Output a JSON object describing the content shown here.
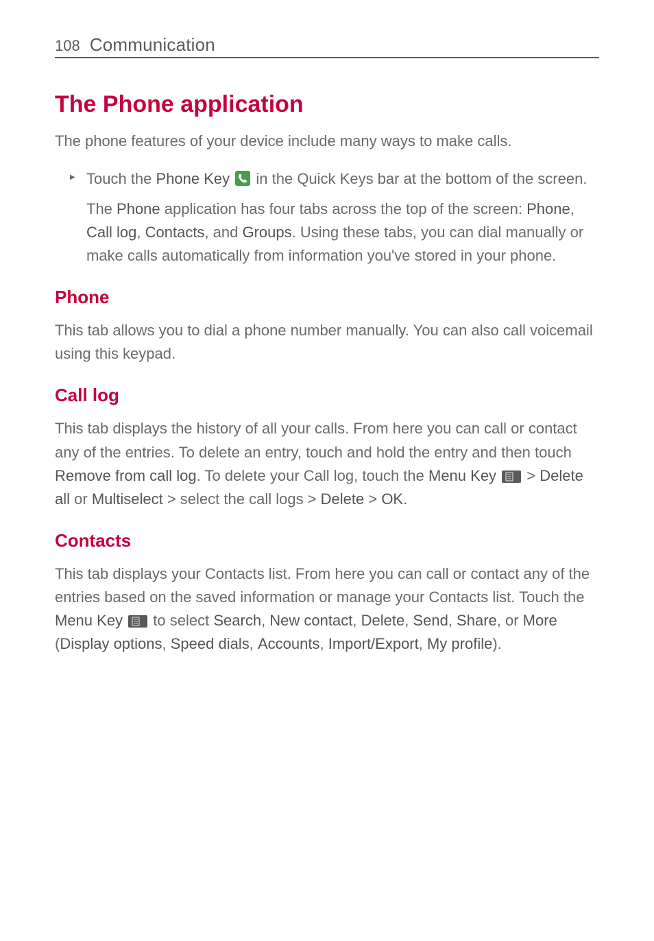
{
  "header": {
    "page_number": "108",
    "section": "Communication"
  },
  "title": "The Phone application",
  "intro": "The phone features of your device include many ways to make calls.",
  "bullet": {
    "pre": "Touch the ",
    "phone_key": "Phone Key",
    "post": " in the Quick Keys bar at the bottom of the screen.",
    "para2_a": "The ",
    "para2_phone": "Phone",
    "para2_b": " application has four tabs across the top of the screen: ",
    "tab1": "Phone",
    "sep1": ", ",
    "tab2": "Call log",
    "sep2": ", ",
    "tab3": "Contacts",
    "sep3": ", and ",
    "tab4": "Groups",
    "para2_c": ". Using these tabs, you can dial manually or make calls automatically from information you've stored in your phone."
  },
  "sections": {
    "phone": {
      "heading": "Phone",
      "body": "This tab allows you to dial a phone number manually. You can also call voicemail using this keypad."
    },
    "calllog": {
      "heading": "Call log",
      "body_a": "This tab displays the history of all your calls. From here you can call or contact any of the entries.  To delete an entry, touch and hold the entry and then touch ",
      "remove": "Remove from call log",
      "body_b": ". To delete your Call log, touch the ",
      "menu_key": "Menu Key",
      "gt1": " > ",
      "delete_all": "Delete all",
      "or": " or ",
      "multiselect": "Multiselect",
      "body_c": " > select the call logs > ",
      "delete": "Delete",
      "gt2": " > ",
      "ok": "OK",
      "period": "."
    },
    "contacts": {
      "heading": "Contacts",
      "body_a": "This tab displays your Contacts list. From here you can call or contact any of the entries based on the saved information or manage your Contacts list. Touch the ",
      "menu_key": "Menu Key",
      "body_b": " to select ",
      "search": "Search",
      "c1": ", ",
      "new_contact": "New contact",
      "c2": ", ",
      "delete": "Delete",
      "c3": ", ",
      "send": "Send",
      "c4": ", ",
      "share": "Share",
      "c5": ", or ",
      "more": "More",
      "paren_open": " (",
      "display_options": "Display options",
      "c6": ", ",
      "speed_dials": "Speed dials",
      "c7": ", ",
      "accounts": "Accounts",
      "c8": ", ",
      "import_export": "Import/Export",
      "c9": ", ",
      "my_profile": "My profile",
      "paren_close": ")."
    }
  }
}
